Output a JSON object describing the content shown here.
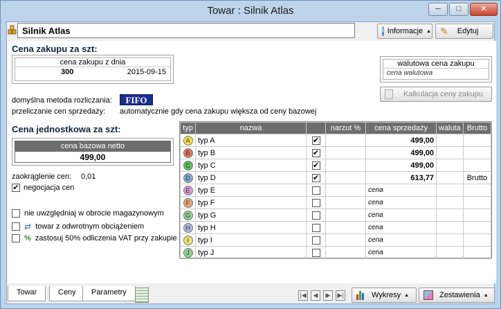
{
  "window": {
    "title": "Towar : Silnik Atlas",
    "minimize": "─",
    "maximize": "□",
    "close": "✕"
  },
  "header": {
    "product_name": "Silnik Atlas",
    "info_label": "Informacje",
    "edit_label": "Edytuj"
  },
  "purchase": {
    "section_title": "Cena zakupu za szt:",
    "by_date_label": "cena zakupu z dnia",
    "price": "300",
    "date": "2015-09-15",
    "currency_label": "walutowa cena zakupu",
    "currency_value": "cena walutowa",
    "calc_button": "Kalkulacja ceny zakupu",
    "method_label": "domyślna metoda rozliczania:",
    "method_value": "FIFO",
    "recalc_label": "przeliczanie cen sprzedaży:",
    "recalc_value": "automatycznie gdy cena zakupu większa od ceny bazowej"
  },
  "unit": {
    "section_title": "Cena jednostkowa za szt:",
    "base_label": "cena bazowa netto",
    "base_value": "499,00",
    "rounding_label": "zaokrąglenie cen:",
    "rounding_value": "0,01",
    "negotiation_label": "negocjacja cen",
    "opt1": "nie uwzględniaj w obrocie magazynowym",
    "opt2": "towar z odwrotnym obciążeniem",
    "opt3": "zastosuj 50% odliczenia VAT przy zakupie"
  },
  "grid": {
    "headers": [
      "typ",
      "nazwa",
      "",
      "narzut %",
      "cena sprzedaży",
      "waluta",
      "Brutto"
    ],
    "rows": [
      {
        "badge": "A",
        "color": "#f7e04a",
        "name": "typ A",
        "checked": true,
        "price": "499,00",
        "brutto": ""
      },
      {
        "badge": "B",
        "color": "#e8785a",
        "name": "typ B",
        "checked": true,
        "price": "499,00",
        "brutto": ""
      },
      {
        "badge": "C",
        "color": "#55c454",
        "name": "typ C",
        "checked": true,
        "price": "499,00",
        "brutto": ""
      },
      {
        "badge": "D",
        "color": "#7aaee0",
        "name": "typ D",
        "checked": true,
        "price": "613,77",
        "brutto": "Brutto"
      },
      {
        "badge": "E",
        "color": "#d59ad8",
        "name": "typ E",
        "checked": false,
        "price": "cena",
        "brutto": ""
      },
      {
        "badge": "F",
        "color": "#eaa276",
        "name": "typ F",
        "checked": false,
        "price": "cena",
        "brutto": ""
      },
      {
        "badge": "G",
        "color": "#8fd58f",
        "name": "typ G",
        "checked": false,
        "price": "cena",
        "brutto": ""
      },
      {
        "badge": "H",
        "color": "#b2b5e0",
        "name": "typ H",
        "checked": false,
        "price": "cena",
        "brutto": ""
      },
      {
        "badge": "I",
        "color": "#f3e26a",
        "name": "typ I",
        "checked": false,
        "price": "cena",
        "brutto": ""
      },
      {
        "badge": "J",
        "color": "#8fd08f",
        "name": "typ J",
        "checked": false,
        "price": "cena",
        "brutto": ""
      }
    ]
  },
  "tabs": [
    "Towar",
    "Ceny",
    "Parametry"
  ],
  "footer": {
    "charts": "Wykresy",
    "reports": "Zestawienia"
  }
}
